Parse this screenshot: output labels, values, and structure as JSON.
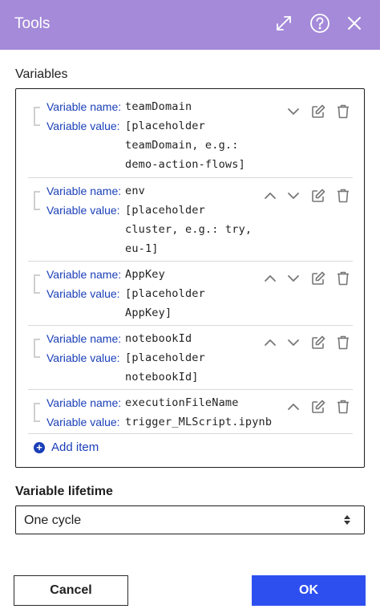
{
  "header": {
    "title": "Tools",
    "expand_icon": "expand-icon",
    "help_icon": "help-icon",
    "close_icon": "close-icon"
  },
  "variables_label": "Variables",
  "variables": [
    {
      "name_label": "Variable name:",
      "name": "teamDomain",
      "value_label": "Variable value:",
      "value_lines": [
        "[placeholder",
        "teamDomain, e.g.:",
        "demo-action-flows]"
      ],
      "actions": [
        "move-down",
        "edit",
        "delete"
      ]
    },
    {
      "name_label": "Variable name:",
      "name": "env",
      "value_label": "Variable value:",
      "value_lines": [
        "[placeholder",
        "cluster, e.g.: try,",
        "eu-1]"
      ],
      "actions": [
        "move-up",
        "move-down",
        "edit",
        "delete"
      ]
    },
    {
      "name_label": "Variable name:",
      "name": "AppKey",
      "value_label": "Variable value:",
      "value_lines": [
        "[placeholder",
        "AppKey]"
      ],
      "actions": [
        "move-up",
        "move-down",
        "edit",
        "delete"
      ]
    },
    {
      "name_label": "Variable name:",
      "name": "notebookId",
      "value_label": "Variable value:",
      "value_lines": [
        "[placeholder",
        "notebookId]"
      ],
      "actions": [
        "move-up",
        "move-down",
        "edit",
        "delete"
      ]
    },
    {
      "name_label": "Variable name:",
      "name": "executionFileName",
      "value_label": "Variable value:",
      "value_lines": [
        "trigger_MLScript.ipynb"
      ],
      "actions": [
        "move-up",
        "edit",
        "delete"
      ]
    }
  ],
  "add_item": {
    "icon": "plus-circle-icon",
    "label": "Add item"
  },
  "lifetime_label": "Variable lifetime",
  "lifetime_select": {
    "value": "One cycle"
  },
  "buttons": {
    "cancel": "Cancel",
    "ok": "OK"
  },
  "colors": {
    "header": "#a48ad9",
    "accent_blue": "#1a3fb8",
    "ok_button": "#2e4ff0"
  }
}
